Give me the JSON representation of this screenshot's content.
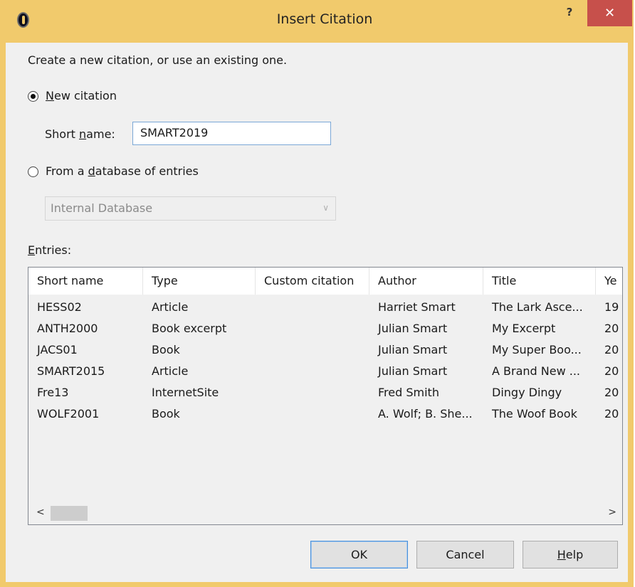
{
  "window": {
    "title": "Insert Citation",
    "help_label": "?",
    "close_label": "✕"
  },
  "dialog": {
    "instruction": "Create a new citation, or use an existing one.",
    "new_citation": {
      "label_prefix": "",
      "label_accel": "N",
      "label_rest": "ew citation",
      "selected": true
    },
    "short_name": {
      "label_prefix": "Short ",
      "label_accel": "n",
      "label_rest": "ame:",
      "value": "SMART2019"
    },
    "from_database": {
      "label_prefix": "From a ",
      "label_accel": "d",
      "label_rest": "atabase of entries",
      "selected": false
    },
    "database_select": {
      "value": "Internal Database",
      "arrow": "∨"
    },
    "entries_label": {
      "label_accel": "E",
      "label_rest": "ntries:"
    },
    "entries": {
      "columns": [
        "Short name",
        "Type",
        "Custom citation",
        "Author",
        "Title",
        "Ye"
      ],
      "rows": [
        [
          "HESS02",
          "Article",
          "",
          "Harriet Smart",
          "The Lark Asce...",
          "19"
        ],
        [
          "ANTH2000",
          "Book excerpt",
          "",
          "Julian Smart",
          "My Excerpt",
          "20"
        ],
        [
          "JACS01",
          "Book",
          "",
          "Julian Smart",
          "My Super Boo...",
          "20"
        ],
        [
          "SMART2015",
          "Article",
          "",
          "Julian Smart",
          "A Brand New ...",
          "20"
        ],
        [
          "Fre13",
          "InternetSite",
          "",
          "Fred Smith",
          "Dingy Dingy",
          "20"
        ],
        [
          "WOLF2001",
          "Book",
          "",
          "A. Wolf; B. She...",
          "The Woof Book",
          "20"
        ]
      ],
      "scroll_left": "<",
      "scroll_right": ">"
    },
    "buttons": {
      "ok": "OK",
      "cancel": "Cancel",
      "help_accel": "H",
      "help_rest": "elp"
    }
  }
}
